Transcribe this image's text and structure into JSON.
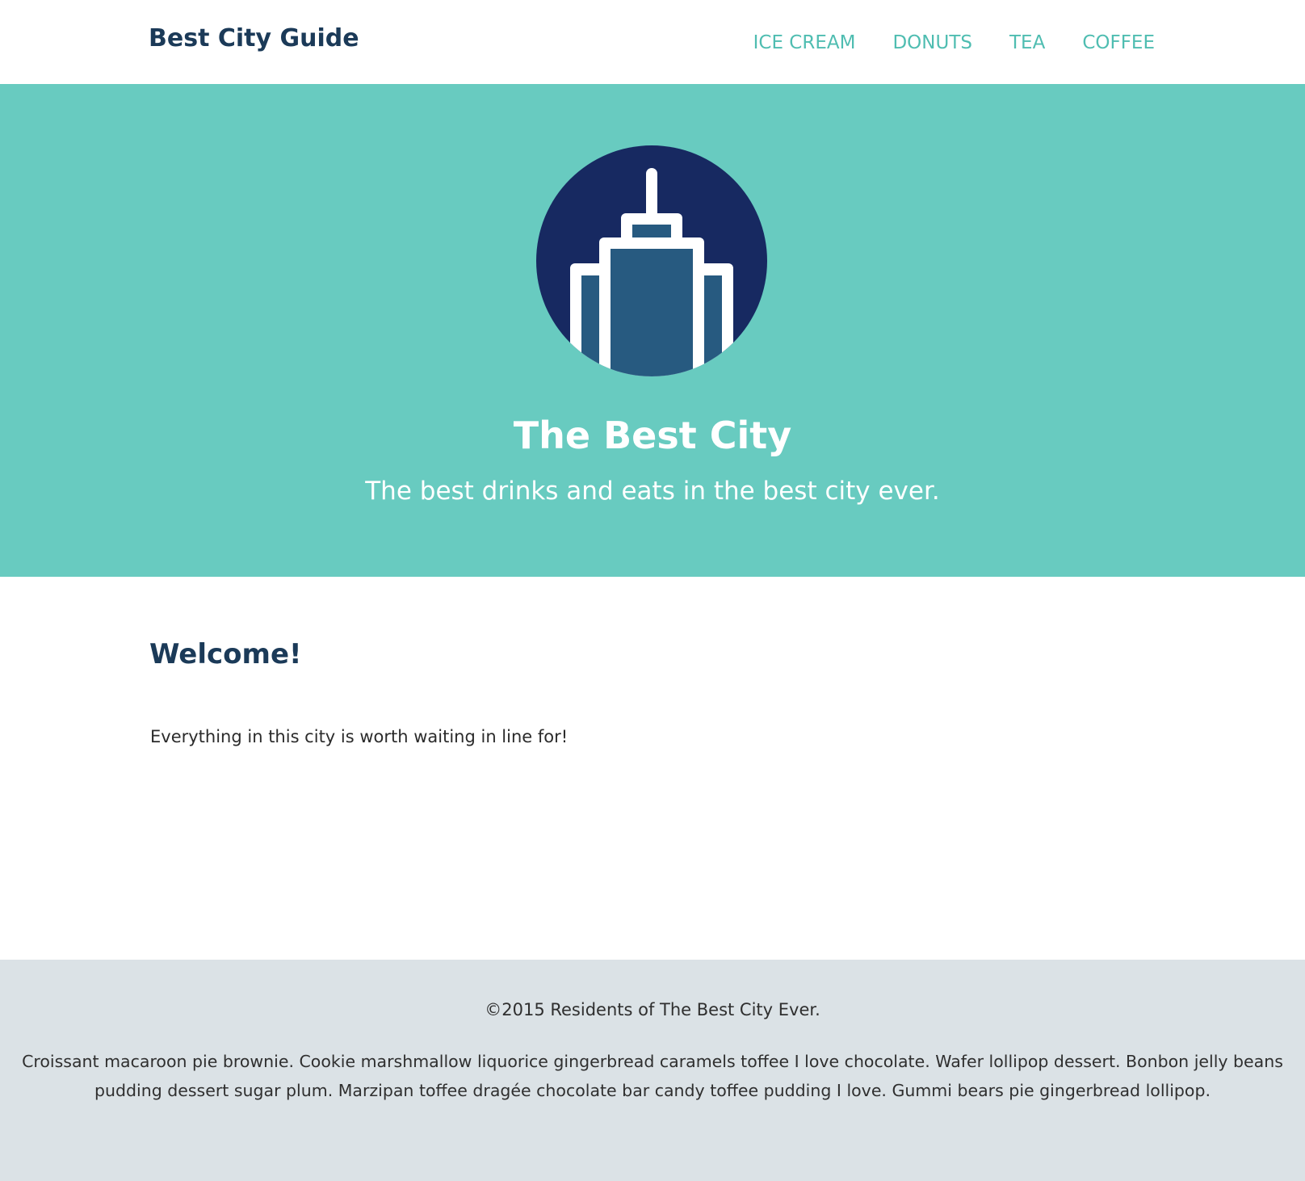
{
  "navbar": {
    "brand": "Best City Guide",
    "links": [
      {
        "label": "ICE CREAM"
      },
      {
        "label": "DONUTS"
      },
      {
        "label": "TEA"
      },
      {
        "label": "COFFEE"
      }
    ]
  },
  "hero": {
    "logo_icon": "skyscraper-icon",
    "title": "The Best City",
    "subtitle": "The best drinks and eats in the best city ever."
  },
  "main": {
    "heading": "Welcome!",
    "text": "Everything in this city is worth waiting in line for!"
  },
  "footer": {
    "copyright": "©2015 Residents of The Best City Ever.",
    "text": "Croissant macaroon pie brownie. Cookie marshmallow liquorice gingerbread caramels toffee I love chocolate. Wafer lollipop dessert. Bonbon jelly beans pudding dessert sugar plum. Marzipan toffee dragée chocolate bar candy toffee pudding I love. Gummi bears pie gingerbread lollipop."
  },
  "colors": {
    "brand_text": "#1b3a58",
    "nav_link": "#4fbdb1",
    "hero_bg": "#68cbc0",
    "logo_circle": "#172961",
    "logo_building": "#275a80",
    "footer_bg": "#dbe2e6"
  }
}
